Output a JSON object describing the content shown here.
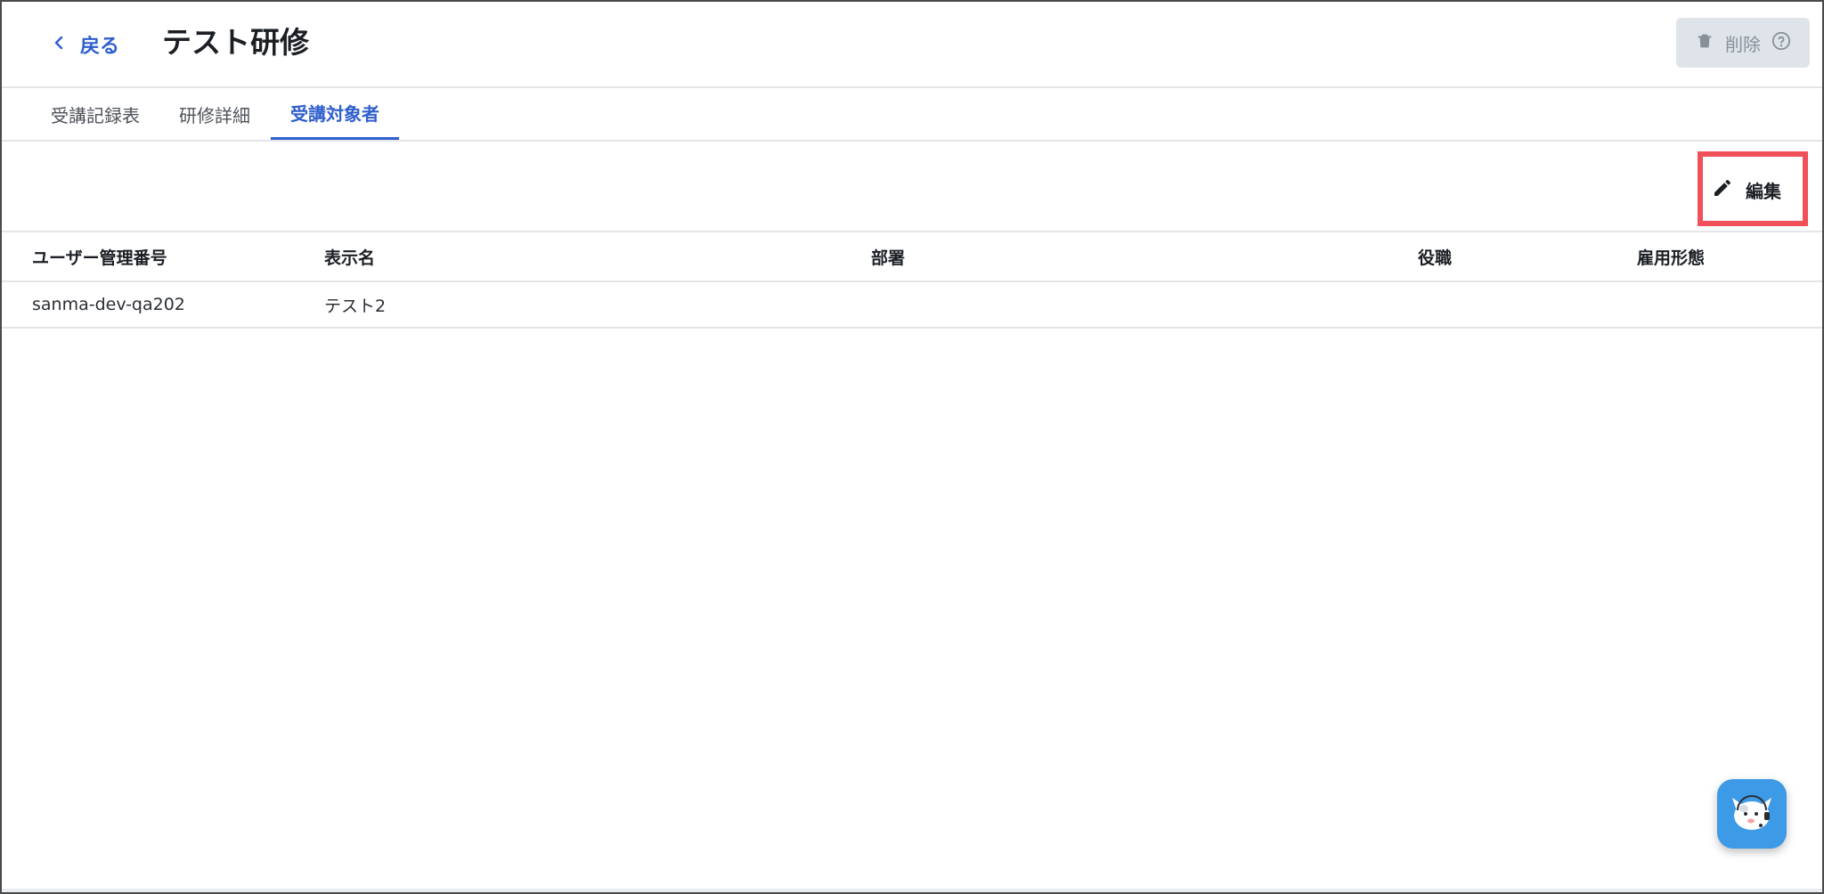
{
  "header": {
    "back_label": "戻る",
    "title": "テスト研修",
    "delete_label": "削除"
  },
  "tabs": [
    {
      "label": "受講記録表",
      "active": false
    },
    {
      "label": "研修詳細",
      "active": false
    },
    {
      "label": "受講対象者",
      "active": true
    }
  ],
  "toolbar": {
    "edit_label": "編集"
  },
  "table": {
    "columns": [
      "ユーザー管理番号",
      "表示名",
      "部署",
      "役職",
      "雇用形態"
    ],
    "rows": [
      [
        "sanma-dev-qa202",
        "テスト2",
        "",
        "",
        ""
      ]
    ]
  },
  "colors": {
    "accent": "#2f5fce",
    "highlight": "#f05059",
    "chat_button": "#3d9ae6"
  },
  "icons": {
    "back": "chevron-left-icon",
    "delete": "trash-icon",
    "help": "question-circle-icon",
    "edit": "pencil-icon",
    "chat": "mascot-icon"
  }
}
